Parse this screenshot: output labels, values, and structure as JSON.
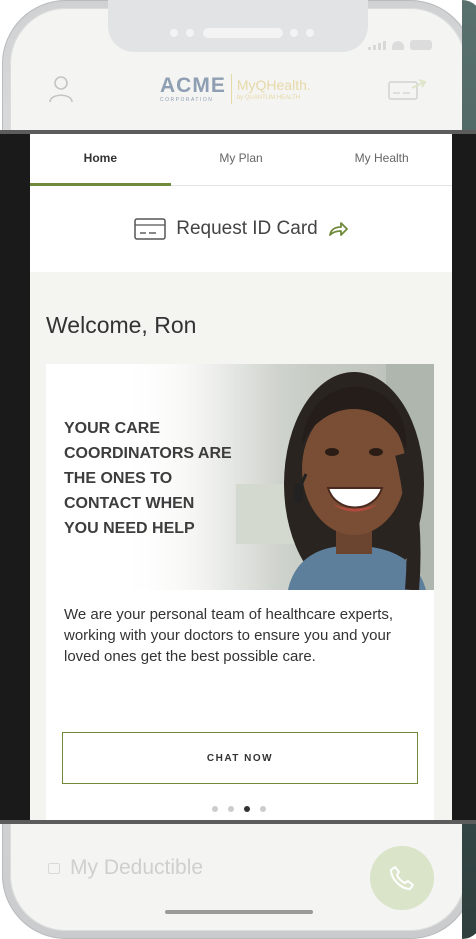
{
  "brand": {
    "logo_main": "ACME",
    "logo_sub": "CORPORATION",
    "partner": "MyQHealth.",
    "partner_by": "by QUANTUM HEALTH"
  },
  "tabs": [
    {
      "label": "Home",
      "active": true
    },
    {
      "label": "My Plan",
      "active": false
    },
    {
      "label": "My Health",
      "active": false
    }
  ],
  "request_id": {
    "label": "Request ID Card",
    "icon": "id-card-icon"
  },
  "welcome": {
    "greeting": "Welcome, Ron"
  },
  "hero": {
    "headline": [
      "YOUR CARE",
      "COORDINATORS ARE",
      "THE ONES TO",
      "CONTACT WHEN",
      "YOU NEED HELP"
    ],
    "body": "We are your personal team of healthcare experts, working with your doctors to ensure you and your loved ones get the best possible care.",
    "button": "CHAT NOW",
    "carousel": {
      "count": 4,
      "active_index": 2
    }
  },
  "bottom": {
    "deductible_label": "My Deductible"
  },
  "colors": {
    "accent": "#6f8a3a",
    "fab": "#d9e4c8",
    "band_edge": "#1a1a1a"
  }
}
